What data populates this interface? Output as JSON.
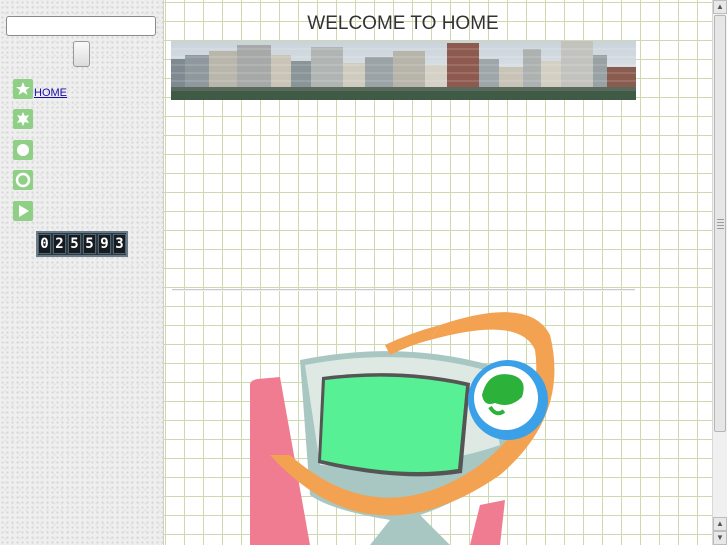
{
  "sidebar": {
    "search": {
      "value": "",
      "placeholder": ""
    },
    "search_button_label": "",
    "nav": [
      {
        "label": "HOME",
        "icon": "star-badge-icon"
      },
      {
        "label": "",
        "icon": "star-badge-icon"
      },
      {
        "label": "",
        "icon": "circle-badge-icon"
      },
      {
        "label": "",
        "icon": "ring-badge-icon"
      },
      {
        "label": "",
        "icon": "play-badge-icon"
      }
    ],
    "counter": [
      "0",
      "2",
      "5",
      "5",
      "9",
      "3"
    ]
  },
  "main": {
    "title": "WELCOME TO HOME"
  },
  "colors": {
    "link": "#1a0dab",
    "icon_green": "#8fcf86",
    "grid": "#cfd9b0"
  }
}
